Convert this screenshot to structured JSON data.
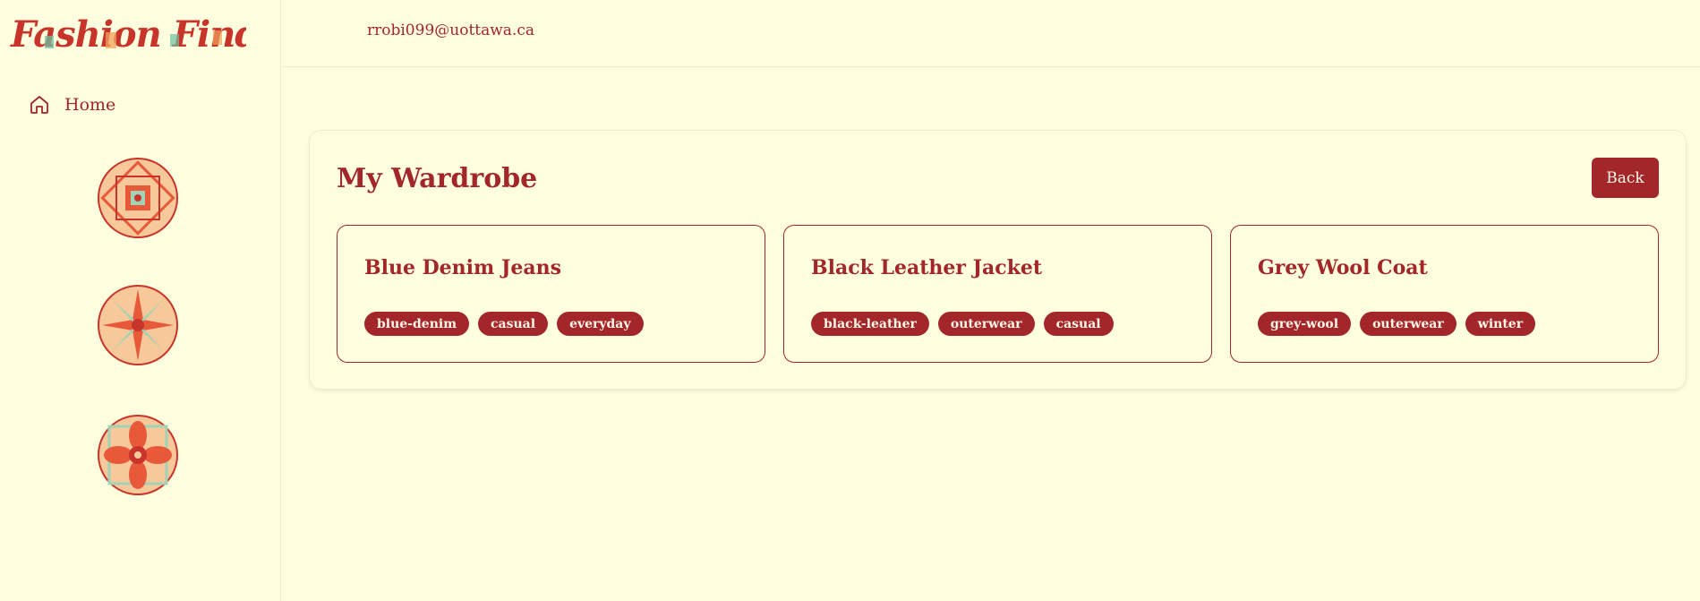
{
  "app": {
    "logo_text": "Fashion Finders"
  },
  "sidebar": {
    "items": [
      {
        "label": "Home",
        "icon": "home-icon"
      }
    ],
    "decorations": [
      "mandala-icon",
      "mandala-icon",
      "mandala-icon"
    ]
  },
  "header": {
    "user_email": "rrobi099@uottawa.ca"
  },
  "page": {
    "title": "My Wardrobe",
    "back_label": "Back"
  },
  "wardrobe": {
    "items": [
      {
        "name": "Blue Denim Jeans",
        "tags": [
          "blue-denim",
          "casual",
          "everyday"
        ]
      },
      {
        "name": "Black Leather Jacket",
        "tags": [
          "black-leather",
          "outerwear",
          "casual"
        ]
      },
      {
        "name": "Grey Wool Coat",
        "tags": [
          "grey-wool",
          "outerwear",
          "winter"
        ]
      }
    ]
  },
  "colors": {
    "background": "#ffffdf",
    "accent": "#a3262a",
    "mandala_orange": "#e8593a",
    "mandala_peach": "#f7c89a",
    "mandala_mint": "#9fd3b5"
  }
}
